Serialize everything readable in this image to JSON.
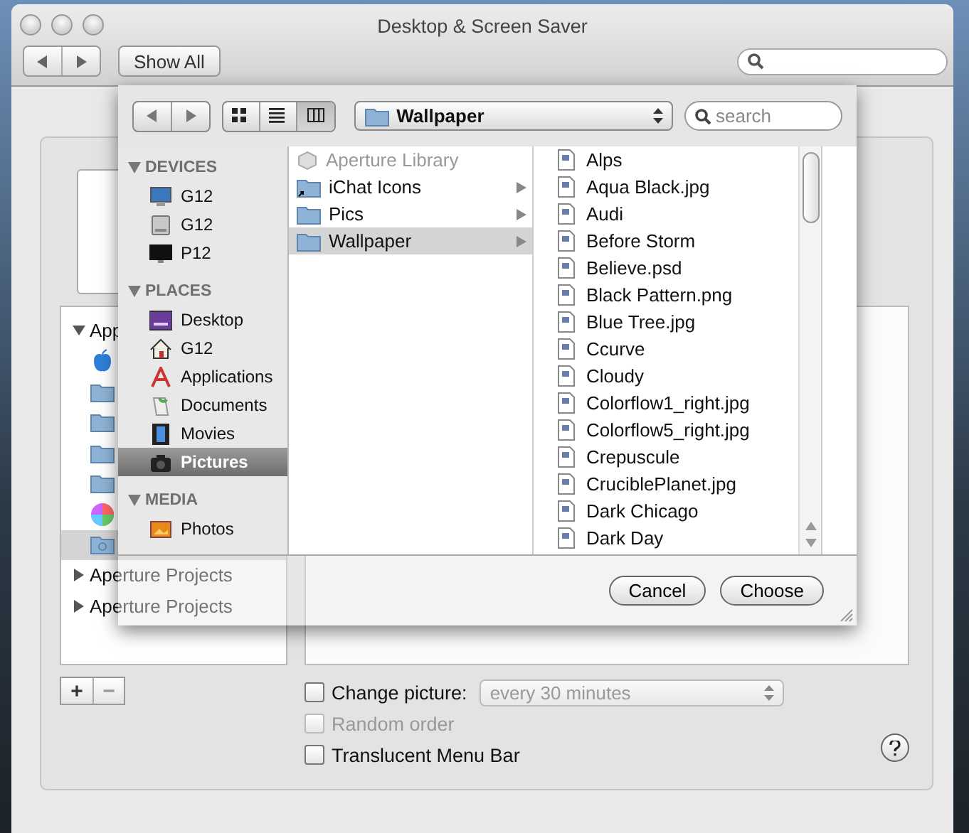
{
  "window": {
    "title": "Desktop & Screen Saver",
    "show_all": "Show All"
  },
  "source_list": [
    {
      "label": "App",
      "expanded": true,
      "children": [
        {
          "kind": "apple",
          "selected": false
        },
        {
          "kind": "folder",
          "selected": false
        },
        {
          "kind": "folder",
          "selected": false
        },
        {
          "kind": "folder",
          "selected": false
        },
        {
          "kind": "folder",
          "selected": false
        },
        {
          "kind": "colors",
          "selected": false
        },
        {
          "kind": "pictures-folder",
          "selected": true
        }
      ]
    },
    {
      "label": "Aperture Projects",
      "expanded": false
    },
    {
      "label": "Aperture Projects",
      "expanded": false
    }
  ],
  "list_buttons": [
    "+",
    "−"
  ],
  "options": [
    {
      "label": "Change picture:",
      "checked": false,
      "disabled": false,
      "interval": "every 30 minutes"
    },
    {
      "label": "Random order",
      "checked": false,
      "disabled": true
    },
    {
      "label": "Translucent Menu Bar",
      "checked": false,
      "disabled": false
    }
  ],
  "sheet": {
    "view_modes": [
      {
        "kind": "icons",
        "selected": false
      },
      {
        "kind": "list",
        "selected": false
      },
      {
        "kind": "columns",
        "selected": true
      }
    ],
    "location": "Wallpaper",
    "search": {
      "placeholder": "search"
    },
    "sidebar": [
      {
        "title": "DEVICES",
        "expanded": true,
        "items": [
          {
            "label": "G12",
            "kind": "display",
            "selected": false
          },
          {
            "label": "G12",
            "kind": "disk",
            "selected": false
          },
          {
            "label": "P12",
            "kind": "monitor",
            "selected": false
          }
        ]
      },
      {
        "title": "PLACES",
        "expanded": true,
        "items": [
          {
            "label": "Desktop",
            "kind": "desktop",
            "selected": false
          },
          {
            "label": "G12",
            "kind": "home",
            "selected": false
          },
          {
            "label": "Applications",
            "kind": "applications",
            "selected": false
          },
          {
            "label": "Documents",
            "kind": "documents",
            "selected": false
          },
          {
            "label": "Movies",
            "kind": "movies",
            "selected": false
          },
          {
            "label": "Pictures",
            "kind": "pictures",
            "selected": true
          }
        ]
      },
      {
        "title": "MEDIA",
        "expanded": true,
        "items": [
          {
            "label": "Photos",
            "kind": "photos",
            "selected": false
          }
        ]
      }
    ],
    "column_1": [
      {
        "label": "Aperture Library",
        "kind": "library",
        "disabled": true,
        "has_children": false,
        "selected": false
      },
      {
        "label": "iChat Icons",
        "kind": "alias-folder",
        "disabled": false,
        "has_children": true,
        "selected": false
      },
      {
        "label": "Pics",
        "kind": "folder",
        "disabled": false,
        "has_children": true,
        "selected": false
      },
      {
        "label": "Wallpaper",
        "kind": "folder",
        "disabled": false,
        "has_children": true,
        "selected": true
      }
    ],
    "column_2": [
      "Alps",
      "Aqua Black.jpg",
      "Audi",
      "Before Storm",
      "Believe.psd",
      "Black Pattern.png",
      "Blue Tree.jpg",
      "Ccurve",
      "Cloudy",
      "Colorflow1_right.jpg",
      "Colorflow5_right.jpg",
      "Crepuscule",
      "CruciblePlanet.jpg",
      "Dark Chicago",
      "Dark Day"
    ],
    "buttons": [
      "Cancel",
      "Choose"
    ]
  }
}
